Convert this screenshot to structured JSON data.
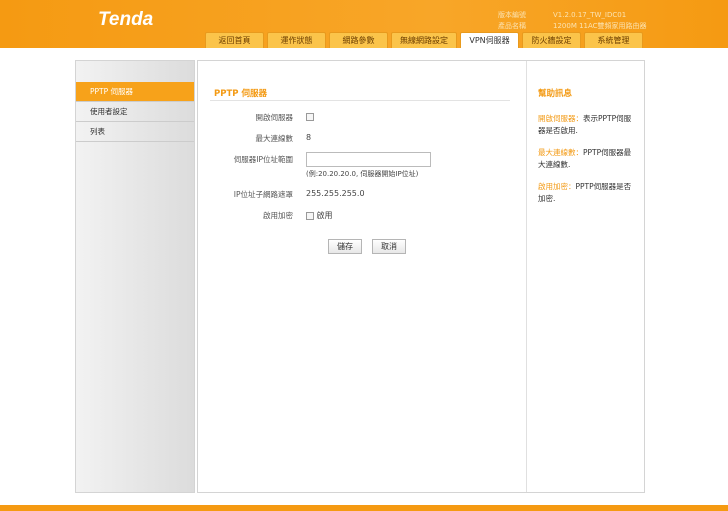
{
  "header": {
    "logo": "Tenda",
    "version_label": "版本編號",
    "version": "V1.2.0.17_TW_IDC01",
    "product_label": "產品名稱",
    "product": "1200M 11AC雙頻家用路由器"
  },
  "tabs": [
    "返回首頁",
    "運作狀態",
    "網路參數",
    "無線網路設定",
    "VPN伺服器",
    "防火牆設定",
    "系統管理"
  ],
  "sidebar": [
    "PPTP 伺服器",
    "使用者設定",
    "列表"
  ],
  "form": {
    "title": "PPTP 伺服器",
    "enable_label": "開啟伺服器",
    "max_label": "最大連線數",
    "max_value": "8",
    "range_label": "伺服器IP位址範圍",
    "range_value": "",
    "range_hint": "(例:20.20.20.0, 伺服器開始IP位址)",
    "mask_label": "IP位址子網路遮罩",
    "mask_value": "255.255.255.0",
    "encrypt_label": "啟用加密",
    "encrypt_option": "啟用",
    "save": "儲存",
    "cancel": "取消"
  },
  "help": {
    "title": "幫助訊息",
    "items": [
      {
        "key": "開啟伺服器：",
        "text": "表示PPTP伺服器是否啟用."
      },
      {
        "key": "最大連線數：",
        "text": "PPTP伺服器最大連線數."
      },
      {
        "key": "啟用加密：",
        "text": "PPTP伺服器是否加密."
      }
    ]
  }
}
